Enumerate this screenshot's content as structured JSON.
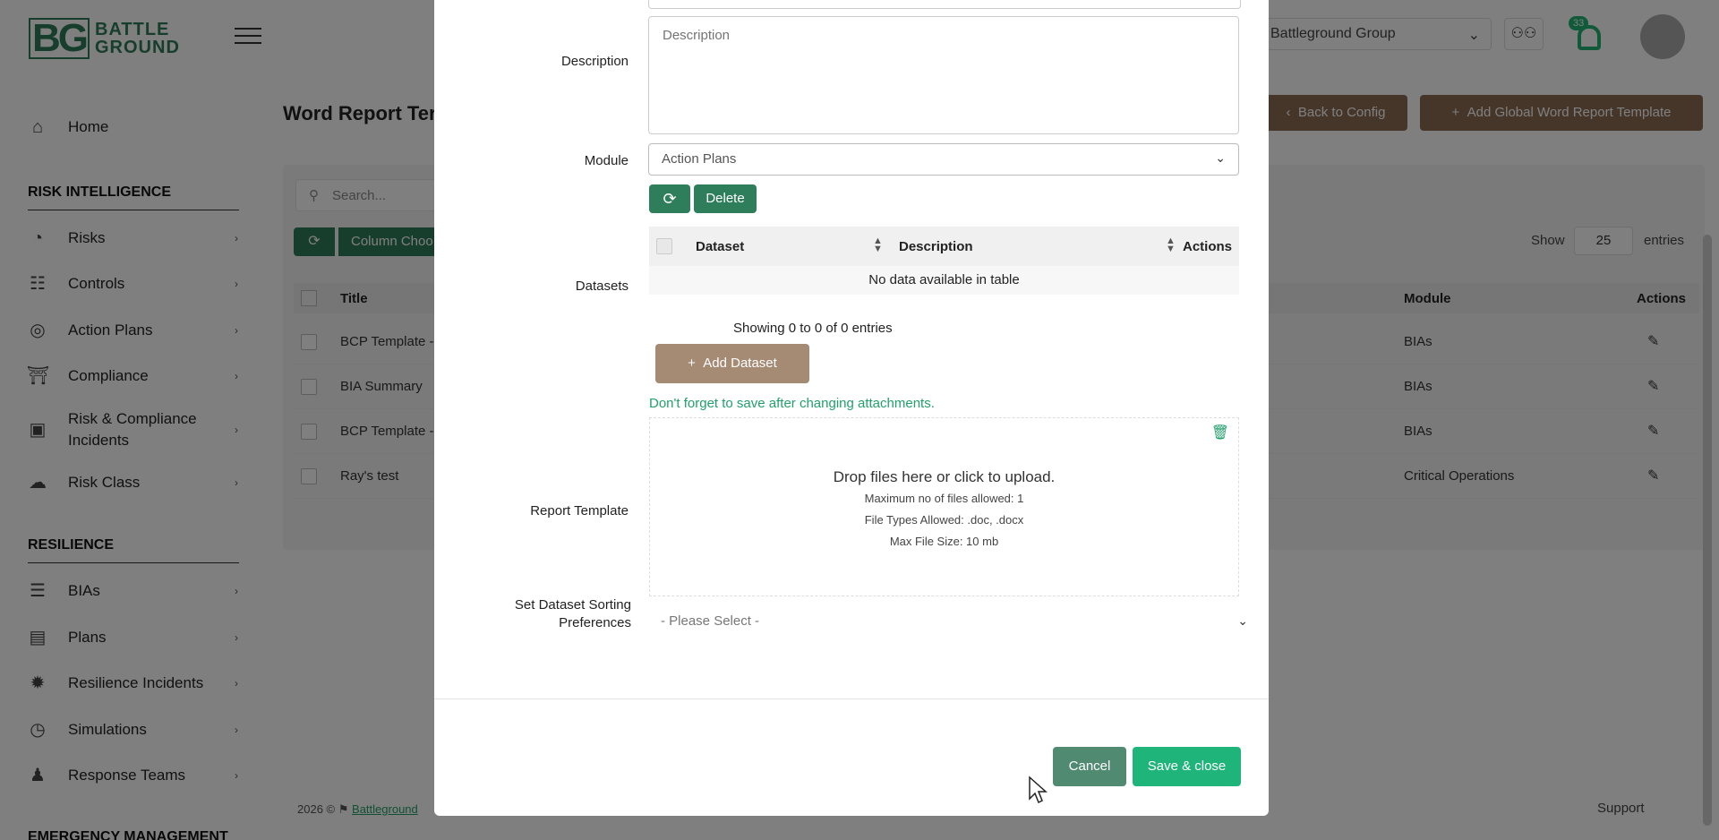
{
  "app": {
    "logo_mark": "BG",
    "logo_line1": "BATTLE",
    "logo_line2": "GROUND",
    "org_select": "Battleground Group",
    "notification_count": "33"
  },
  "sidebar": {
    "home": "Home",
    "section_risk": "RISK INTELLIGENCE",
    "risk_items": [
      "Risks",
      "Controls",
      "Action Plans",
      "Compliance",
      "Risk & Compliance Incidents",
      "Risk Class"
    ],
    "section_resilience": "RESILIENCE",
    "resilience_items": [
      "BIAs",
      "Plans",
      "Resilience Incidents",
      "Simulations",
      "Response Teams"
    ],
    "section_emergency": "EMERGENCY MANAGEMENT"
  },
  "page": {
    "title": "Word Report Ter",
    "back_button": "Back to Config",
    "add_button": "Add Global Word Report Template",
    "search_placeholder": "Search...",
    "column_chooser": "Column Choo",
    "show_label": "Show",
    "show_value": "25",
    "entries_label": "entries",
    "table_headers": {
      "title": "Title",
      "module": "Module",
      "actions": "Actions"
    },
    "rows": [
      {
        "title": "BCP Template -",
        "module": "BIAs"
      },
      {
        "title": "BIA Summary",
        "module": "BIAs"
      },
      {
        "title": "BCP Template -",
        "module": "BIAs"
      },
      {
        "title": "Ray's test",
        "module": "Critical Operations"
      }
    ],
    "footer_year": "2026 ©",
    "footer_link": "Battleground",
    "support": "Support"
  },
  "modal": {
    "description_label": "Description",
    "description_placeholder": "Description",
    "module_label": "Module",
    "module_value": "Action Plans",
    "delete_button": "Delete",
    "datasets_label": "Datasets",
    "datasets_headers": {
      "dataset": "Dataset",
      "description": "Description",
      "actions": "Actions"
    },
    "no_data": "No data available in table",
    "showing": "Showing 0 to 0 of 0 entries",
    "add_dataset_button": "Add Dataset",
    "save_note": "Don't forget to save after changing attachments.",
    "report_template_label": "Report Template",
    "dropzone_title": "Drop files here or click to upload.",
    "dropzone_max_files": "Maximum no of files allowed: 1",
    "dropzone_file_types": "File Types Allowed: .doc, .docx",
    "dropzone_max_size": "Max File Size: 10 mb",
    "sorting_label_line1": "Set Dataset Sorting",
    "sorting_label_line2": "Preferences",
    "sorting_placeholder": "- Please Select -",
    "cancel_button": "Cancel",
    "save_button": "Save & close"
  }
}
